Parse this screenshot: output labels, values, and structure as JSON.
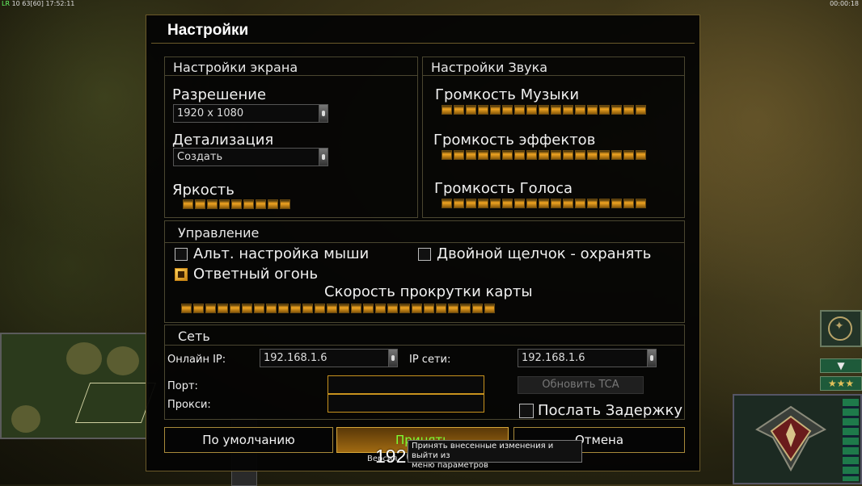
{
  "hud": {
    "top_left_prefix": "LR",
    "top_left_stats": "10 63",
    "top_left_fps": "[60]",
    "top_left_time": "17:52:11",
    "top_right_time": "00:00:18"
  },
  "dialog": {
    "title": "Настройки",
    "screen": {
      "header": "Настройки экрана",
      "resolution_label": "Разрешение",
      "resolution_value": "1920 x 1080",
      "detail_label": "Детализация",
      "detail_value": "Создать",
      "brightness_label": "Яркость",
      "brightness_level": 1.0
    },
    "sound": {
      "header": "Настройки Звука",
      "music_label": "Громкость Музыки",
      "music_level": 1.0,
      "effects_label": "Громкость эффектов",
      "effects_level": 1.0,
      "voice_label": "Громкость Голоса",
      "voice_level": 1.0
    },
    "controls": {
      "header": "Управление",
      "alt_mouse_label": "Альт. настройка мыши",
      "alt_mouse_checked": false,
      "double_click_label": "Двойной щелчок - охранять",
      "double_click_checked": false,
      "return_fire_label": "Ответный огонь",
      "return_fire_checked": true,
      "scroll_speed_label": "Скорость прокрутки карты",
      "scroll_speed_level": 1.0
    },
    "network": {
      "header": "Сеть",
      "online_ip_label": "Онлайн IP:",
      "online_ip_value": "192.168.1.6",
      "lan_ip_label": "IP сети:",
      "lan_ip_value": "192.168.1.6",
      "port_label": "Порт:",
      "port_value": "",
      "proxy_label": "Прокси:",
      "proxy_value": "",
      "update_tca_label": "Обновить TCA",
      "send_delay_label": "Послать Задержку",
      "send_delay_checked": false
    },
    "buttons": {
      "default_label": "По умолчанию",
      "accept_label": "Принять",
      "cancel_label": "Отмена"
    },
    "tooltip": {
      "line1": "Принять внесенные изменения и выйти из",
      "line2": "меню параметров"
    },
    "overlay_resolution": "1920 x 1080",
    "version_fragment": "Версия"
  }
}
